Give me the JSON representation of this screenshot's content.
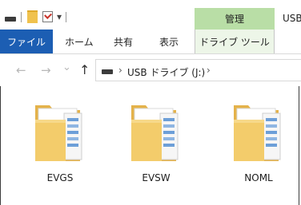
{
  "qat": {
    "icons": [
      "drive-icon",
      "folder-icon",
      "properties-check-icon",
      "customize-arrow-icon"
    ],
    "pin_glyph": "▾"
  },
  "title": {
    "context_tab": "管理",
    "window_title": "USB"
  },
  "ribbon": {
    "tabs": [
      {
        "label": "ファイル",
        "active": true
      },
      {
        "label": "ホーム"
      },
      {
        "label": "共有"
      },
      {
        "label": "表示"
      },
      {
        "label": "ドライブ ツール"
      }
    ],
    "file_color": "#1c5eb3",
    "context_color": "#b9dea6"
  },
  "address": {
    "back": "←",
    "forward": "→",
    "recent": "⌄",
    "up": "↑",
    "sep1": "›",
    "path": "USB ドライブ (J:)",
    "sep2": "›"
  },
  "items": [
    {
      "name": "EVGS"
    },
    {
      "name": "EVSW"
    },
    {
      "name": "NOML"
    }
  ]
}
